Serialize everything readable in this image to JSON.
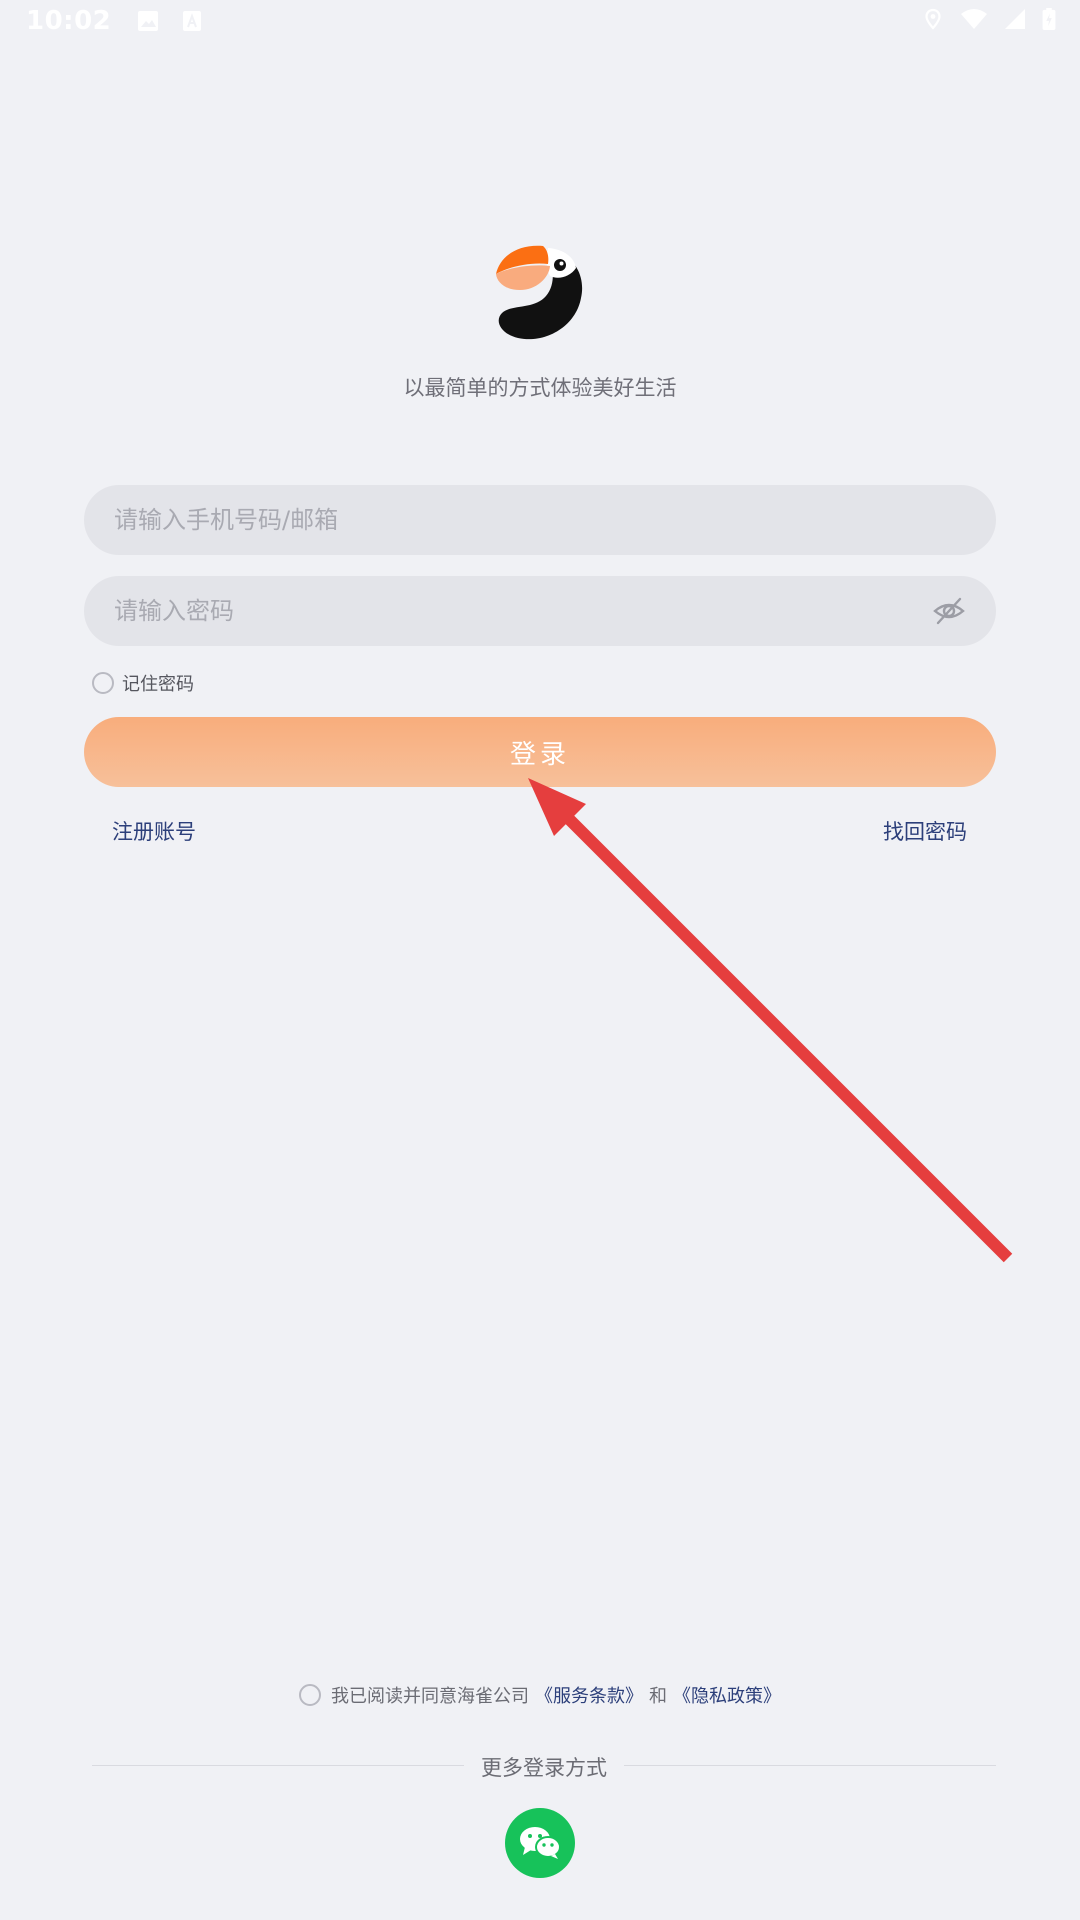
{
  "status_bar": {
    "time": "10:02",
    "left_icons": [
      "image-icon",
      "font-icon"
    ],
    "right_icons": [
      "location-icon",
      "wifi-icon",
      "signal-icon",
      "battery-icon"
    ]
  },
  "brand": {
    "logo": "toucan-logo",
    "tagline": "以最简单的方式体验美好生活"
  },
  "form": {
    "phone_placeholder": "请输入手机号码/邮箱",
    "password_placeholder": "请输入密码",
    "remember_label": "记住密码",
    "login_label": "登录",
    "register_label": "注册账号",
    "forgot_label": "找回密码"
  },
  "agreement": {
    "prefix": "我已阅读并同意海雀公司",
    "terms": "《服务条款》",
    "and": "和",
    "privacy": "《隐私政策》"
  },
  "more_login": {
    "label": "更多登录方式",
    "options": [
      "wechat-icon"
    ]
  },
  "colors": {
    "accent": "#f8ad7c",
    "link": "#2c3f7a",
    "wechat": "#17c25a",
    "annotation_arrow": "#e53e3e"
  }
}
